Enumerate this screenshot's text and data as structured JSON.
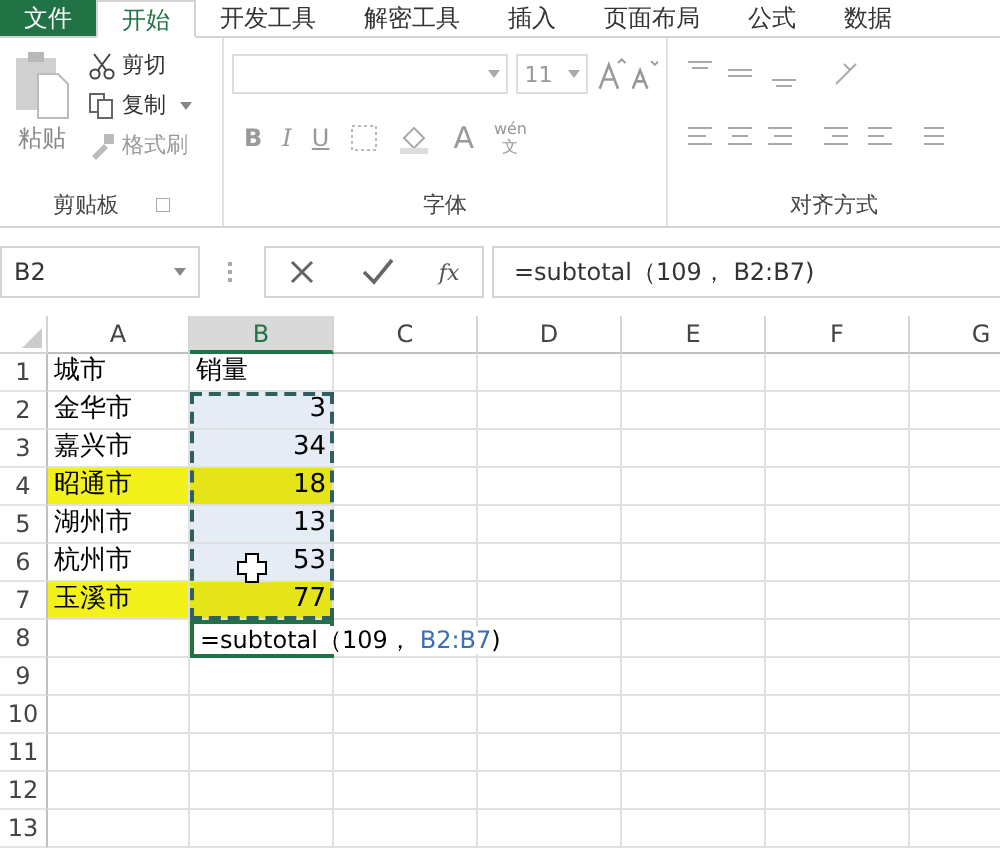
{
  "ribbon_tabs": [
    {
      "label": "文件",
      "kind": "file",
      "selected": false
    },
    {
      "label": "开始",
      "kind": "tab",
      "selected": true
    },
    {
      "label": "开发工具",
      "kind": "tab",
      "selected": false
    },
    {
      "label": "解密工具",
      "kind": "tab",
      "selected": false
    },
    {
      "label": "插入",
      "kind": "tab",
      "selected": false
    },
    {
      "label": "页面布局",
      "kind": "tab",
      "selected": false
    },
    {
      "label": "公式",
      "kind": "tab",
      "selected": false
    },
    {
      "label": "数据",
      "kind": "tab",
      "selected": false
    }
  ],
  "clipboard": {
    "paste": "粘贴",
    "cut": "剪切",
    "copy": "复制",
    "format_painter": "格式刷",
    "label": "剪贴板"
  },
  "font": {
    "size": "11",
    "bold": "B",
    "italic": "I",
    "underline": "U",
    "font_color": "A",
    "phonetic_top": "wén",
    "phonetic_bottom": "文",
    "label": "字体"
  },
  "alignment": {
    "label": "对齐方式"
  },
  "name_box": "B2",
  "formula": "=subtotal（109， B2:B7)",
  "function_button": "fx",
  "columns": [
    {
      "label": "A",
      "selected": false
    },
    {
      "label": "B",
      "selected": true
    },
    {
      "label": "C",
      "selected": false
    },
    {
      "label": "D",
      "selected": false
    },
    {
      "label": "E",
      "selected": false
    },
    {
      "label": "F",
      "selected": false
    },
    {
      "label": "G",
      "selected": false
    }
  ],
  "rows": [
    {
      "number": "1",
      "highlighted": false,
      "cells": [
        {
          "text": "城市",
          "selected": false
        },
        {
          "text": "销量",
          "selected": false
        }
      ]
    },
    {
      "number": "2",
      "highlighted": false,
      "cells": [
        {
          "text": "金华市",
          "selected": false
        },
        {
          "text": "3",
          "selected": true
        }
      ]
    },
    {
      "number": "3",
      "highlighted": false,
      "cells": [
        {
          "text": "嘉兴市",
          "selected": false
        },
        {
          "text": "34",
          "selected": true
        }
      ]
    },
    {
      "number": "4",
      "highlighted": true,
      "cells": [
        {
          "text": "昭通市",
          "selected": false
        },
        {
          "text": "18",
          "selected": true
        }
      ]
    },
    {
      "number": "5",
      "highlighted": false,
      "cells": [
        {
          "text": "湖州市",
          "selected": false
        },
        {
          "text": "13",
          "selected": true
        }
      ]
    },
    {
      "number": "6",
      "highlighted": false,
      "cells": [
        {
          "text": "杭州市",
          "selected": false
        },
        {
          "text": "53",
          "selected": true
        }
      ]
    },
    {
      "number": "7",
      "highlighted": true,
      "cells": [
        {
          "text": "玉溪市",
          "selected": false
        },
        {
          "text": "77",
          "selected": true
        }
      ]
    },
    {
      "number": "8",
      "edit": {
        "text": "=subtotal（109，",
        "reference": "B2:B7",
        "close": ")"
      }
    },
    {
      "number": "9"
    },
    {
      "number": "10"
    },
    {
      "number": "11"
    },
    {
      "number": "12"
    },
    {
      "number": "13"
    }
  ]
}
